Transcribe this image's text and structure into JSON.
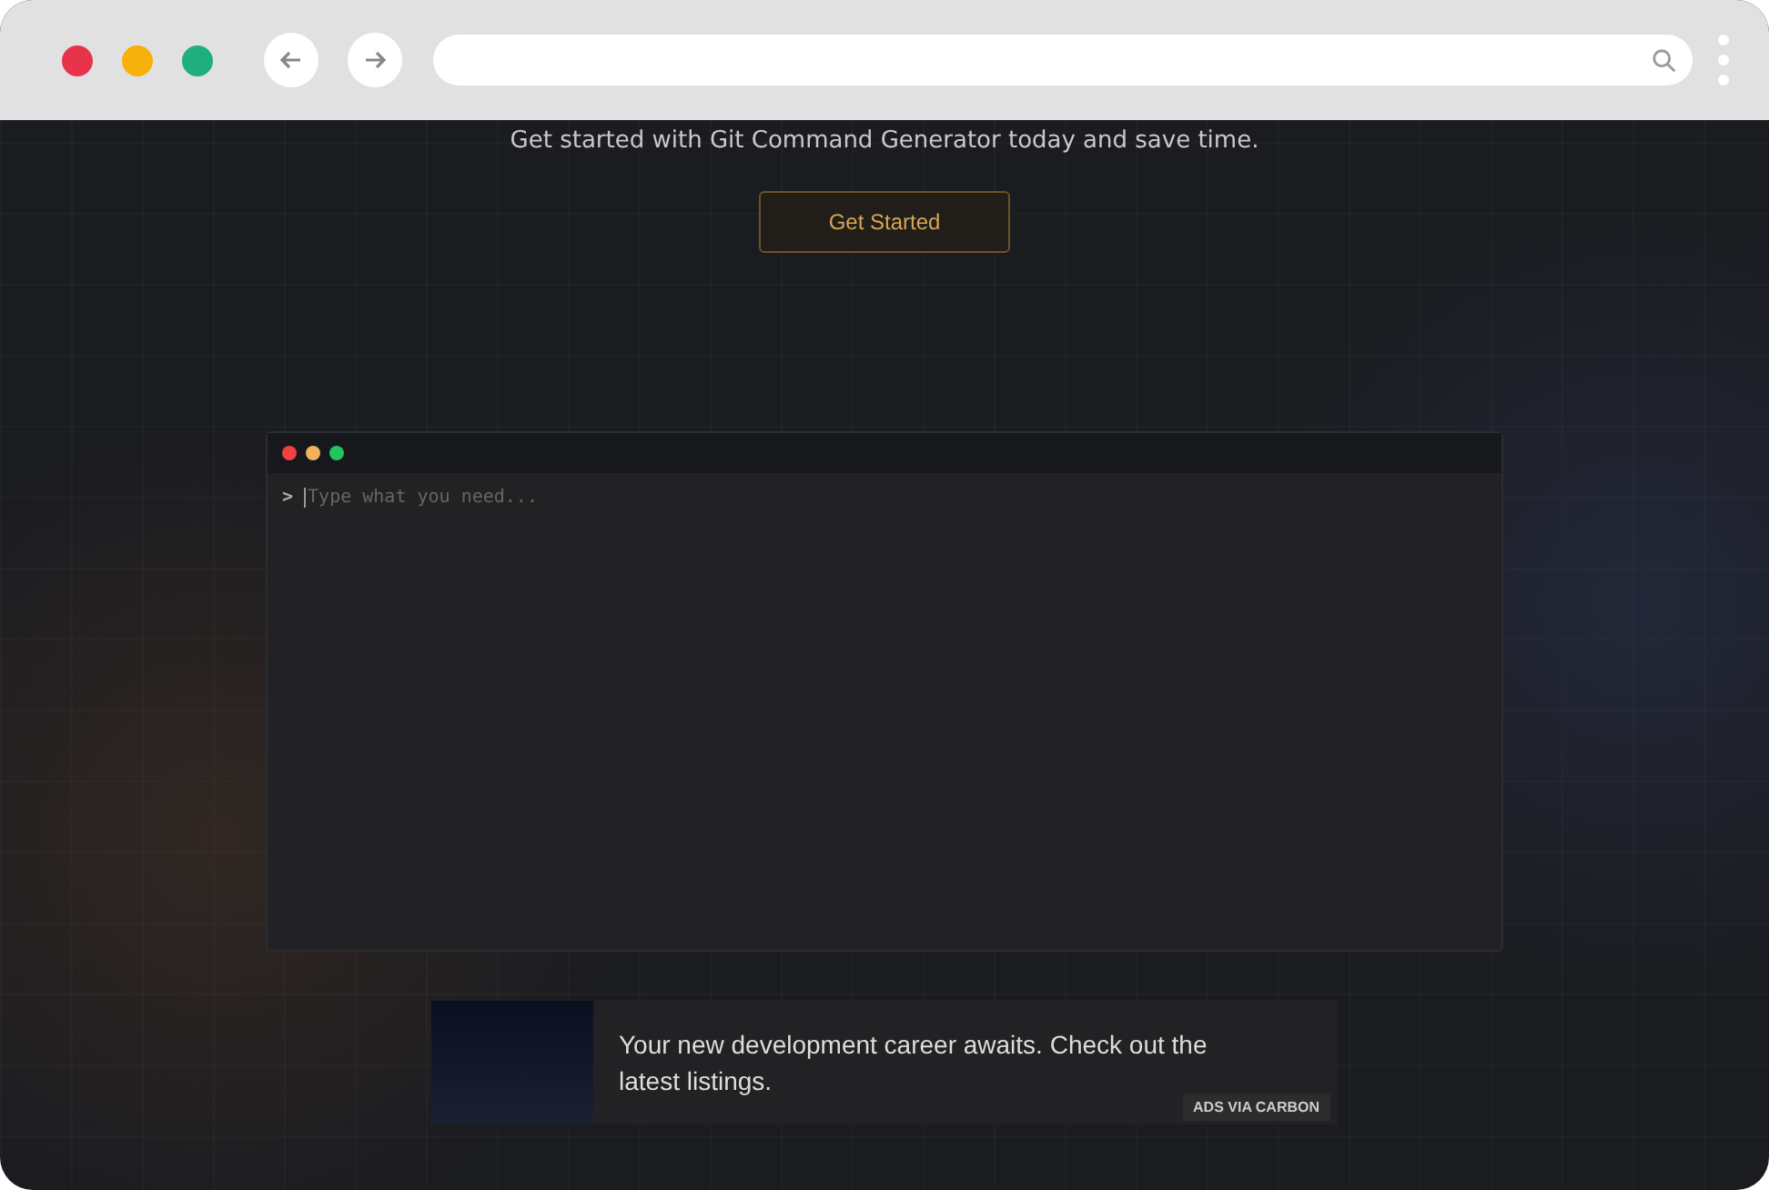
{
  "hero": {
    "subtitle": "Get started with Git Command Generator today and save time.",
    "cta": "Get Started"
  },
  "terminal": {
    "prompt": ">",
    "placeholder": "Type what you need..."
  },
  "ad": {
    "text": "Your new development career awaits. Check out the latest listings.",
    "badge": "ADS VIA CARBON"
  }
}
